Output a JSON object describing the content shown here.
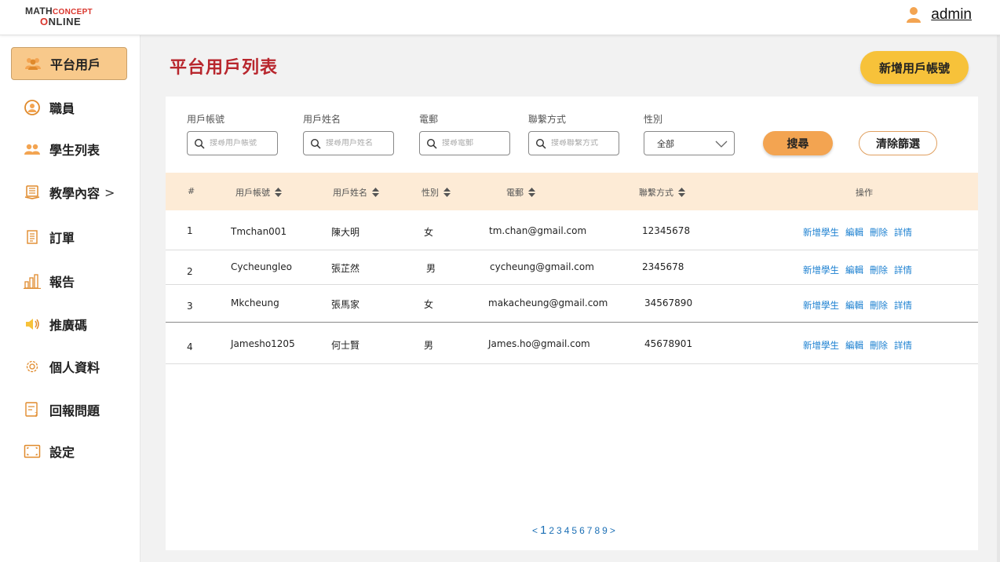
{
  "logo": {
    "line1_a": "M",
    "line1_b": "ATH",
    "line1_c": "CONCEPT",
    "line2_o": "O",
    "line2_rest": "NLINE"
  },
  "user": {
    "name": "admin"
  },
  "sidebar": {
    "items": [
      {
        "label": "平台用戶",
        "icon": "users-icon",
        "active": true
      },
      {
        "label": "職員",
        "icon": "staff-icon"
      },
      {
        "label": "學生列表",
        "icon": "students-icon"
      },
      {
        "label": "教學內容",
        "icon": "book-icon",
        "chevron": ">"
      },
      {
        "label": "訂單",
        "icon": "receipt-icon"
      },
      {
        "label": "報告",
        "icon": "bar-chart-icon"
      },
      {
        "label": "推廣碼",
        "icon": "speaker-icon"
      },
      {
        "label": "個人資料",
        "icon": "gear-icon"
      },
      {
        "label": "回報問題",
        "icon": "report-issue-icon"
      },
      {
        "label": "設定",
        "icon": "settings-frame-icon"
      }
    ]
  },
  "page": {
    "title": "平台用戶列表",
    "add_button": "新增用戶帳號"
  },
  "filters": {
    "account": {
      "label": "用戶帳號",
      "placeholder": "搜尋用戶帳號"
    },
    "name": {
      "label": "用戶姓名",
      "placeholder": "搜尋用戶姓名"
    },
    "email": {
      "label": "電郵",
      "placeholder": "搜尋電郵"
    },
    "contact": {
      "label": "聯繫方式",
      "placeholder": "搜尋聯繫方式"
    },
    "gender": {
      "label": "性別",
      "value": "全部"
    },
    "search_button": "搜尋",
    "clear_button": "清除篩選"
  },
  "table": {
    "headers": {
      "index": "#",
      "account": "用戶帳號",
      "name": "用戶姓名",
      "gender": "性別",
      "email": "電郵",
      "contact": "聯繫方式",
      "actions": "操作"
    },
    "action_labels": {
      "add_student": "新增學生",
      "edit": "編輯",
      "delete": "刪除",
      "details": "詳情"
    },
    "rows": [
      {
        "index": "1",
        "account": "Tmchan001",
        "name": "陳大明",
        "gender": "女",
        "email": "tm.chan@gmail.com",
        "contact": "12345678"
      },
      {
        "index": "2",
        "account": "Cycheungleo",
        "name": "張芷然",
        "gender": "男",
        "email": "cycheung@gmail.com",
        "contact": "2345678"
      },
      {
        "index": "3",
        "account": "Mkcheung",
        "name": "張馬家",
        "gender": "女",
        "email": "makacheung@gmail.com",
        "contact": "34567890"
      },
      {
        "index": "4",
        "account": "Jamesho1205",
        "name": "何士賢",
        "gender": "男",
        "email": "James.ho@gmail.com",
        "contact": "45678901"
      }
    ]
  },
  "pagination": {
    "prev": "<",
    "current": "1",
    "pages": [
      "2",
      "3",
      "4",
      "5",
      "6",
      "7",
      "8",
      "9"
    ],
    "next": ">"
  },
  "colors": {
    "accent_orange": "#f3a451",
    "add_yellow": "#f7c23a",
    "title_red": "#b8262d",
    "link_blue": "#1a7fd0",
    "header_bg": "#fdebd6",
    "active_nav": "#f8c98b"
  }
}
